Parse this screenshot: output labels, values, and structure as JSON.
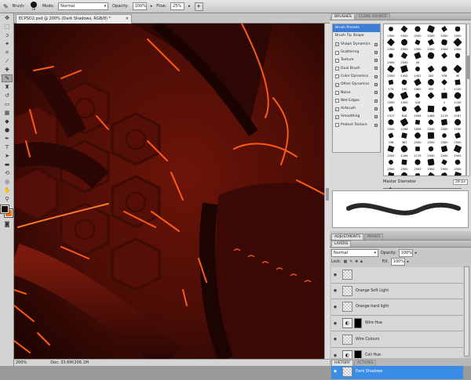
{
  "options_bar": {
    "brush_label": "Brush:",
    "brush_size": "28",
    "mode_label": "Mode:",
    "mode_value": "Normal",
    "opacity_label": "Opacity:",
    "opacity_value": "100%",
    "flow_label": "Flow:",
    "flow_value": "25%"
  },
  "document": {
    "tab_title": "ECPSD2.psd @ 200% (Dark Shadows, RGB/8) *"
  },
  "status": {
    "zoom": "200%",
    "doc_info": "Doc: 33.6M/206.1M"
  },
  "brushes_panel": {
    "tabs": [
      "BRUSHES",
      "CLONE SOURCE"
    ],
    "items": [
      {
        "label": "Brush Presets",
        "check": false,
        "selected": true,
        "lock": false
      },
      {
        "label": "Brush Tip Shape",
        "check": false,
        "selected": false,
        "lock": false,
        "nobox": true
      },
      {
        "label": "Shape Dynamics",
        "check": true,
        "selected": false,
        "lock": true
      },
      {
        "label": "Scattering",
        "check": false,
        "selected": false,
        "lock": true
      },
      {
        "label": "Texture",
        "check": false,
        "selected": false,
        "lock": true
      },
      {
        "label": "Dual Brush",
        "check": false,
        "selected": false,
        "lock": true
      },
      {
        "label": "Color Dynamics",
        "check": false,
        "selected": false,
        "lock": true
      },
      {
        "label": "Other Dynamics",
        "check": true,
        "selected": false,
        "lock": true
      },
      {
        "label": "Noise",
        "check": false,
        "selected": false,
        "lock": true
      },
      {
        "label": "Wet Edges",
        "check": false,
        "selected": false,
        "lock": true
      },
      {
        "label": "Airbrush",
        "check": true,
        "selected": false,
        "lock": true
      },
      {
        "label": "Smoothing",
        "check": true,
        "selected": false,
        "lock": true
      },
      {
        "label": "Protect Texture",
        "check": false,
        "selected": false,
        "lock": true
      }
    ],
    "preset_sizes": [
      "2500",
      "2500",
      "2500",
      "2500",
      "2500",
      "2500",
      "2500",
      "2500",
      "2500",
      "2500",
      "2500",
      "2500",
      "2500",
      "2500",
      "45",
      "",
      "",
      " ",
      "2500",
      "1452",
      "1452",
      "300",
      "978",
      "90",
      "174",
      "100",
      "1660",
      "995",
      "1",
      "1100",
      "2500",
      "1000",
      "418",
      "",
      "1",
      "1100",
      "2317",
      "826",
      "2094",
      "1464",
      "2119",
      "2167",
      "2500",
      "1166",
      "1856",
      "2500",
      "2500",
      "1535",
      "798",
      "387",
      "2500",
      "2500",
      "2500",
      "2500",
      "2500",
      "1164",
      "2119",
      "2500",
      "2500",
      "2500",
      "2500",
      "2500",
      "2500",
      "2500",
      "2500",
      "2500",
      "2500",
      "",
      "2500",
      "",
      "2500",
      ""
    ],
    "master_diameter_label": "Master Diameter",
    "master_diameter_value": "28 px"
  },
  "adjustments_panel": {
    "tabs": [
      "ADJUSTMENTS",
      "MASKS"
    ]
  },
  "layers_panel": {
    "tab": "LAYERS",
    "blend_mode": "Normal",
    "opacity_label": "Opacity:",
    "opacity_value": "100%",
    "lock_label": "Lock:",
    "fill_label": "Fill:",
    "fill_value": "100%",
    "layers": [
      {
        "name": "",
        "type": "pixel",
        "selected": false
      },
      {
        "name": "Orange Soft Light",
        "type": "pixel",
        "selected": false
      },
      {
        "name": "Orange hard light",
        "type": "pixel",
        "selected": false
      },
      {
        "name": "Wire Hue",
        "type": "adjust",
        "selected": false
      },
      {
        "name": "Wire Colours",
        "type": "pixel",
        "selected": false
      },
      {
        "name": "Coil Hue",
        "type": "adjust",
        "selected": false
      },
      {
        "name": "Dark Shadows",
        "type": "pixel",
        "selected": true
      }
    ]
  },
  "history_panel": {
    "tabs": [
      "HISTORY",
      "ACTIONS"
    ]
  }
}
